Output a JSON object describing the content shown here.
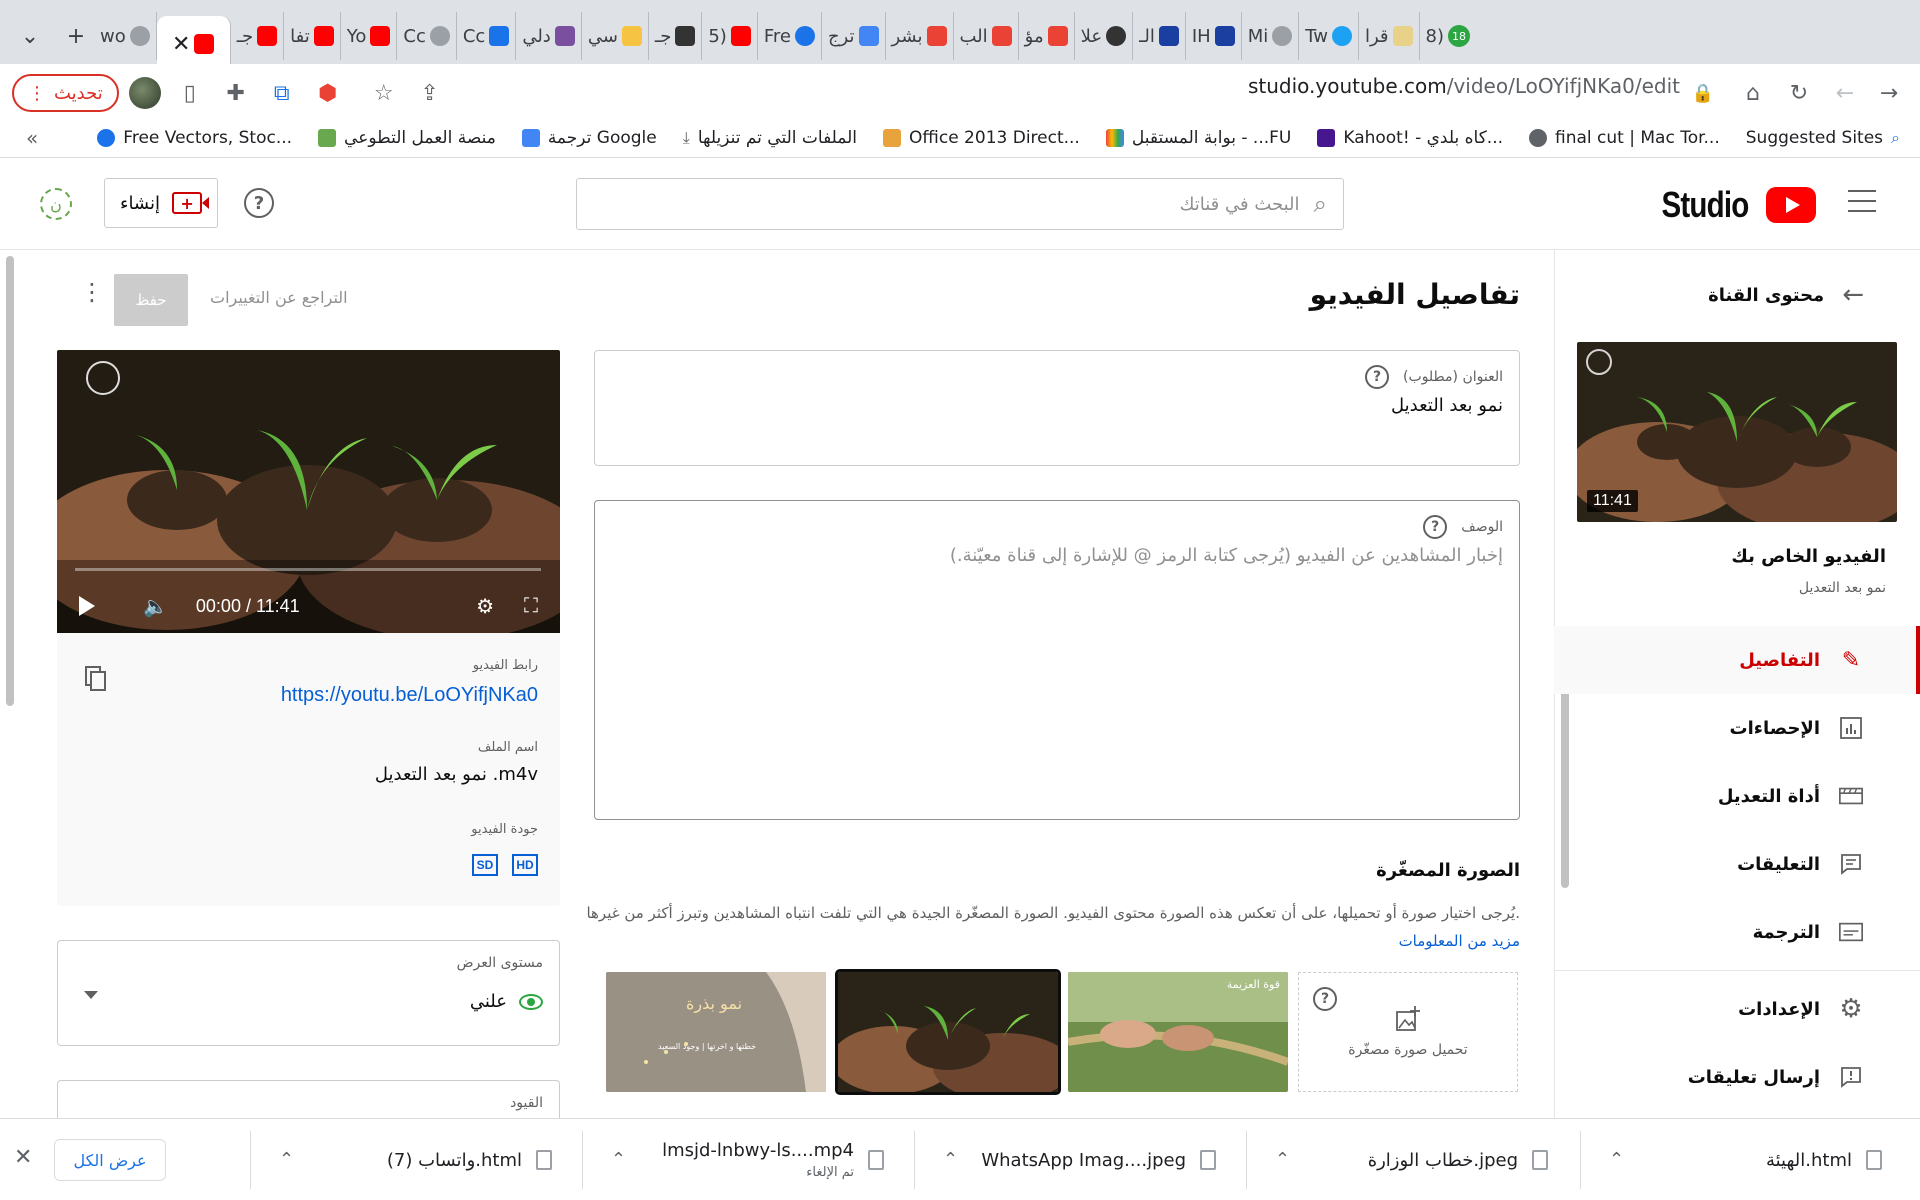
{
  "browser": {
    "tabs": [
      "wo",
      "جـ",
      "تفا",
      "Yo",
      "Cc",
      "Cc",
      "دلي",
      "سي",
      "جـ",
      "5)",
      "Fre",
      "ترج",
      "بشر",
      "الب",
      "مؤ",
      "علا",
      "الـ",
      "IH",
      "Mi",
      "Tw",
      "قرا",
      "8)"
    ],
    "tab_badge": "18",
    "reload_label": "تحديث",
    "url_host": "studio.youtube.com",
    "url_path": "/video/LoOYifjNKa0/edit",
    "bookmarks": [
      "Suggested Sites",
      "final cut | Mac Tor...",
      "Kahoot! - كاه بلدي...",
      "بوابة المستقبل - ...FU",
      "Office 2013 Direct...",
      "الملفات التي تم تنزيلها",
      "ترجمة Google",
      "منصة العمل التطوعي",
      "Free Vectors, Stoc..."
    ],
    "bookmarks_overflow": "«"
  },
  "header": {
    "logo_text": "Studio",
    "search_placeholder": "البحث في قناتك",
    "create_label": "إنشاء",
    "help_glyph": "?",
    "channel_avatar_glyph": "ن"
  },
  "sidebar": {
    "back_label": "محتوى القناة",
    "duration": "11:41",
    "video_title": "الفيديو الخاص بك",
    "video_subtitle": "نمو بعد التعديل",
    "items": [
      {
        "label": "التفاصيل",
        "icon": "pencil-icon",
        "glyph": "✎",
        "active": true
      },
      {
        "label": "الإحصاءات",
        "icon": "analytics-icon",
        "glyph": "📊",
        "active": false
      },
      {
        "label": "أداة التعديل",
        "icon": "editor-icon",
        "glyph": "🎬",
        "active": false
      },
      {
        "label": "التعليقات",
        "icon": "comments-icon",
        "glyph": "💬",
        "active": false
      },
      {
        "label": "الترجمة",
        "icon": "subtitles-icon",
        "glyph": "☰",
        "active": false
      },
      {
        "label": "الإعدادات",
        "icon": "gear-icon",
        "glyph": "⚙",
        "active": false
      },
      {
        "label": "إرسال تعليقات",
        "icon": "feedback-icon",
        "glyph": "!",
        "active": false
      }
    ]
  },
  "main": {
    "page_title": "تفاصيل الفيديو",
    "undo_label": "التراجع عن التغييرات",
    "save_label": "حفظ",
    "title_field": {
      "label": "العنوان (مطلوب)",
      "value": "نمو بعد التعديل"
    },
    "description_field": {
      "label": "الوصف",
      "placeholder": "إخبار المشاهدين عن الفيديو (يُرجى كتابة الرمز @ للإشارة إلى قناة معيّنة.)"
    },
    "thumbnail": {
      "title": "الصورة المصغّرة",
      "description": "يُرجى اختيار صورة أو تحميلها، على أن تعكس هذه الصورة محتوى الفيديو. الصورة المصغّرة الجيدة هي التي تلفت انتباه المشاهدين وتبرز أكثر من غيرها.",
      "more_link": "مزيد من المعلومات",
      "upload_label": "تحميل صورة مصغّرة",
      "tile1_text": "نمو بذرة",
      "tile1_sub": "خطتها و اخرتها | وجود السعيد",
      "tile3_text": "قوة العزيمة"
    }
  },
  "video_card": {
    "time": "00:00 / 11:41",
    "link_label": "رابط الفيديو",
    "link_url": "https://youtu.be/LoOYifjNKa0",
    "file_label": "اسم الملف",
    "file_name": "نمو بعد التعديل .m4v",
    "quality_label": "جودة الفيديو",
    "badges": [
      "HD",
      "SD"
    ]
  },
  "visibility": {
    "label": "مستوى العرض",
    "value": "علني"
  },
  "restrictions": {
    "label": "القيود"
  },
  "downloads": {
    "show_all": "عرض الكل",
    "items": [
      {
        "name": "الهيئة.html",
        "status": ""
      },
      {
        "name": "خطاب الوزارة.jpeg",
        "status": ""
      },
      {
        "name": "WhatsApp Imag....jpeg",
        "status": ""
      },
      {
        "name": "lmsjd-lnbwy-ls....mp4",
        "status": "تم الإلغاء"
      },
      {
        "name": "واتساب (7).html",
        "status": ""
      }
    ]
  },
  "colors": {
    "accent_red": "#cc0000",
    "link_blue": "#065fd4",
    "public_green": "#2ba640",
    "reload_red": "#d93025"
  }
}
